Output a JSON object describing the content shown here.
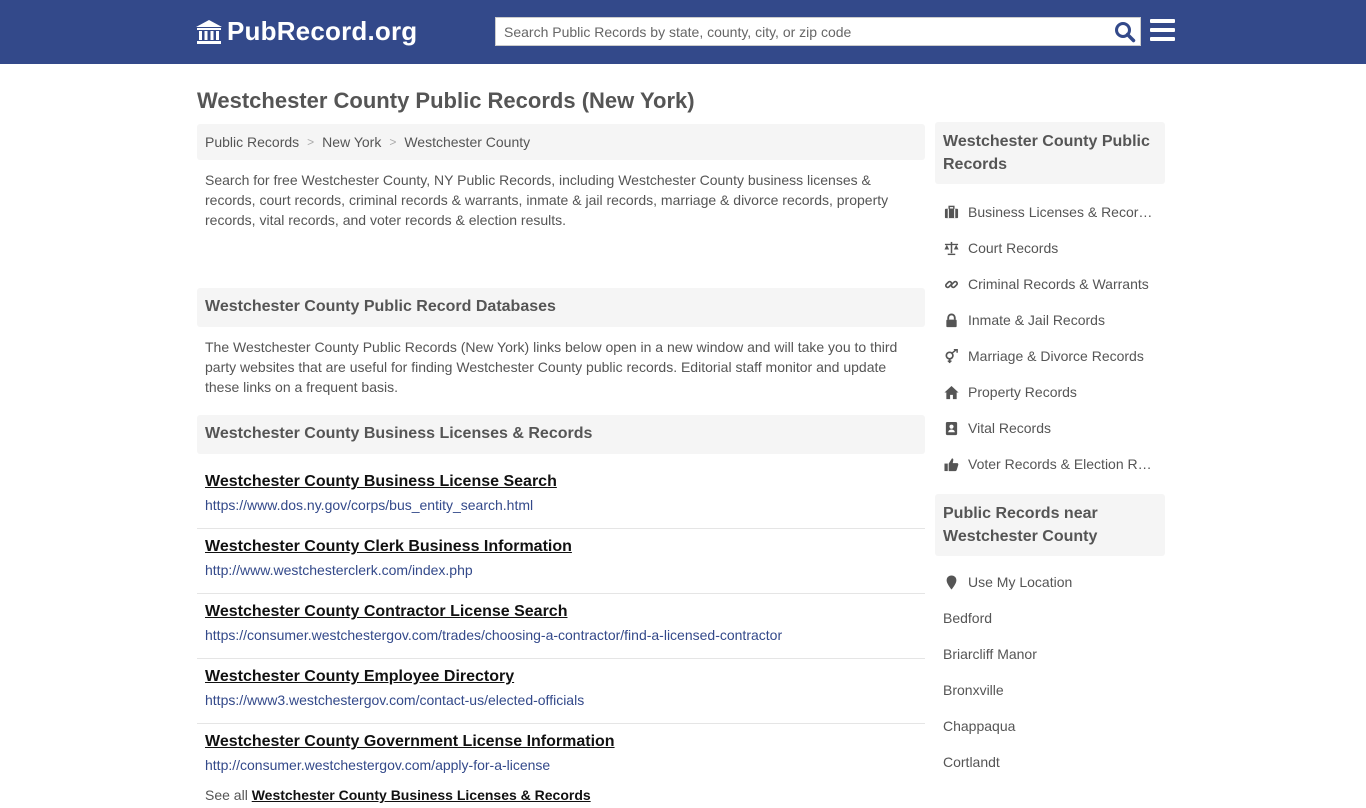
{
  "header": {
    "logo_text": "PubRecord.org",
    "search_placeholder": "Search Public Records by state, county, city, or zip code"
  },
  "page": {
    "title": "Westchester County Public Records (New York)"
  },
  "breadcrumb": [
    "Public Records",
    "New York",
    "Westchester County"
  ],
  "intro": "Search for free Westchester County, NY Public Records, including Westchester County business licenses & records, court records, criminal records & warrants, inmate & jail records, marriage & divorce records, property records, vital records, and voter records & election results.",
  "databases": {
    "heading": "Westchester County Public Record Databases",
    "text": "The Westchester County Public Records (New York) links below open in a new window and will take you to third party websites that are useful for finding Westchester County public records. Editorial staff monitor and update these links on a frequent basis."
  },
  "business": {
    "heading": "Westchester County Business Licenses & Records",
    "links": [
      {
        "title": "Westchester County Business License Search",
        "url": "https://www.dos.ny.gov/corps/bus_entity_search.html"
      },
      {
        "title": "Westchester County Clerk Business Information",
        "url": "http://www.westchesterclerk.com/index.php"
      },
      {
        "title": "Westchester County Contractor License Search",
        "url": "https://consumer.westchestergov.com/trades/choosing-a-contractor/find-a-licensed-contractor"
      },
      {
        "title": "Westchester County Employee Directory",
        "url": "https://www3.westchestergov.com/contact-us/elected-officials"
      },
      {
        "title": "Westchester County Government License Information",
        "url": "http://consumer.westchestergov.com/apply-for-a-license"
      }
    ],
    "see_all_prefix": "See all",
    "see_all_link": "Westchester County Business Licenses & Records"
  },
  "sidebar": {
    "heading": "Westchester County Public Records",
    "items": [
      {
        "label": "Business Licenses & Records",
        "icon": "briefcase-icon"
      },
      {
        "label": "Court Records",
        "icon": "scale-icon"
      },
      {
        "label": "Criminal Records & Warrants",
        "icon": "link-icon"
      },
      {
        "label": "Inmate & Jail Records",
        "icon": "lock-icon"
      },
      {
        "label": "Marriage & Divorce Records",
        "icon": "gender-icon"
      },
      {
        "label": "Property Records",
        "icon": "home-icon"
      },
      {
        "label": "Vital Records",
        "icon": "contact-book-icon"
      },
      {
        "label": "Voter Records & Election Results",
        "icon": "thumbs-up-icon"
      }
    ],
    "near_heading": "Public Records near Westchester County",
    "use_location": "Use My Location",
    "near_places": [
      "Bedford",
      "Briarcliff Manor",
      "Bronxville",
      "Chappaqua",
      "Cortlandt"
    ]
  },
  "colors": {
    "header_bg": "#33498a",
    "link_url": "#33498a",
    "panel_bg": "#f5f5f5"
  }
}
